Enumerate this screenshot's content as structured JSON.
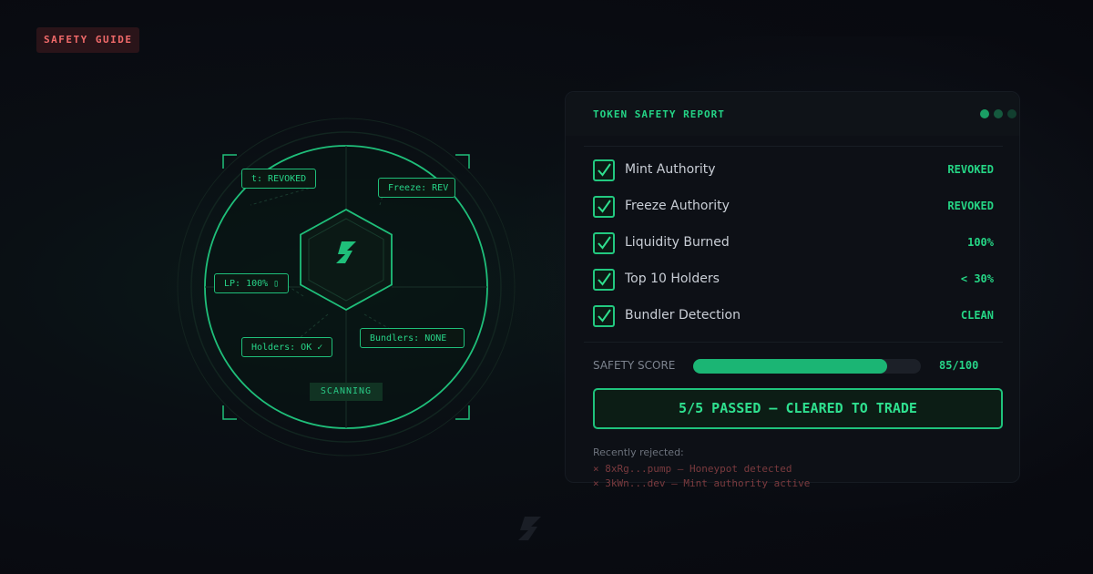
{
  "tag": {
    "label": "SAFETY GUIDE"
  },
  "radar": {
    "chips": {
      "mint": "t: REVOKED",
      "freeze": "Freeze: REV",
      "lp": "LP: 100% ▯",
      "holders": "Holders: OK ✓",
      "bundlers": "Bundlers: NONE"
    },
    "status": "SCANNING"
  },
  "report": {
    "title": "TOKEN SAFETY REPORT",
    "checks": [
      {
        "label": "Mint Authority",
        "value": "REVOKED"
      },
      {
        "label": "Freeze Authority",
        "value": "REVOKED"
      },
      {
        "label": "Liquidity Burned",
        "value": "100%"
      },
      {
        "label": "Top 10 Holders",
        "value": "< 30%"
      },
      {
        "label": "Bundler Detection",
        "value": "CLEAN"
      }
    ],
    "score": {
      "label": "SAFETY SCORE",
      "value": 85,
      "max": 100,
      "text": "85/100"
    },
    "verdict": "5/5 PASSED — CLEARED TO TRADE",
    "rejected_title": "Recently rejected:",
    "rejected": [
      "× 8xRg...pump — Honeypot detected",
      "× 3kWn...dev — Mint authority active"
    ]
  },
  "colors": {
    "accent": "#22c980",
    "danger": "#f06a6a",
    "panel": "#0d1016"
  },
  "icons": {
    "logo": "s-bolt-logo-icon",
    "check": "check-icon",
    "watermark": "s-bolt-logo-icon"
  }
}
